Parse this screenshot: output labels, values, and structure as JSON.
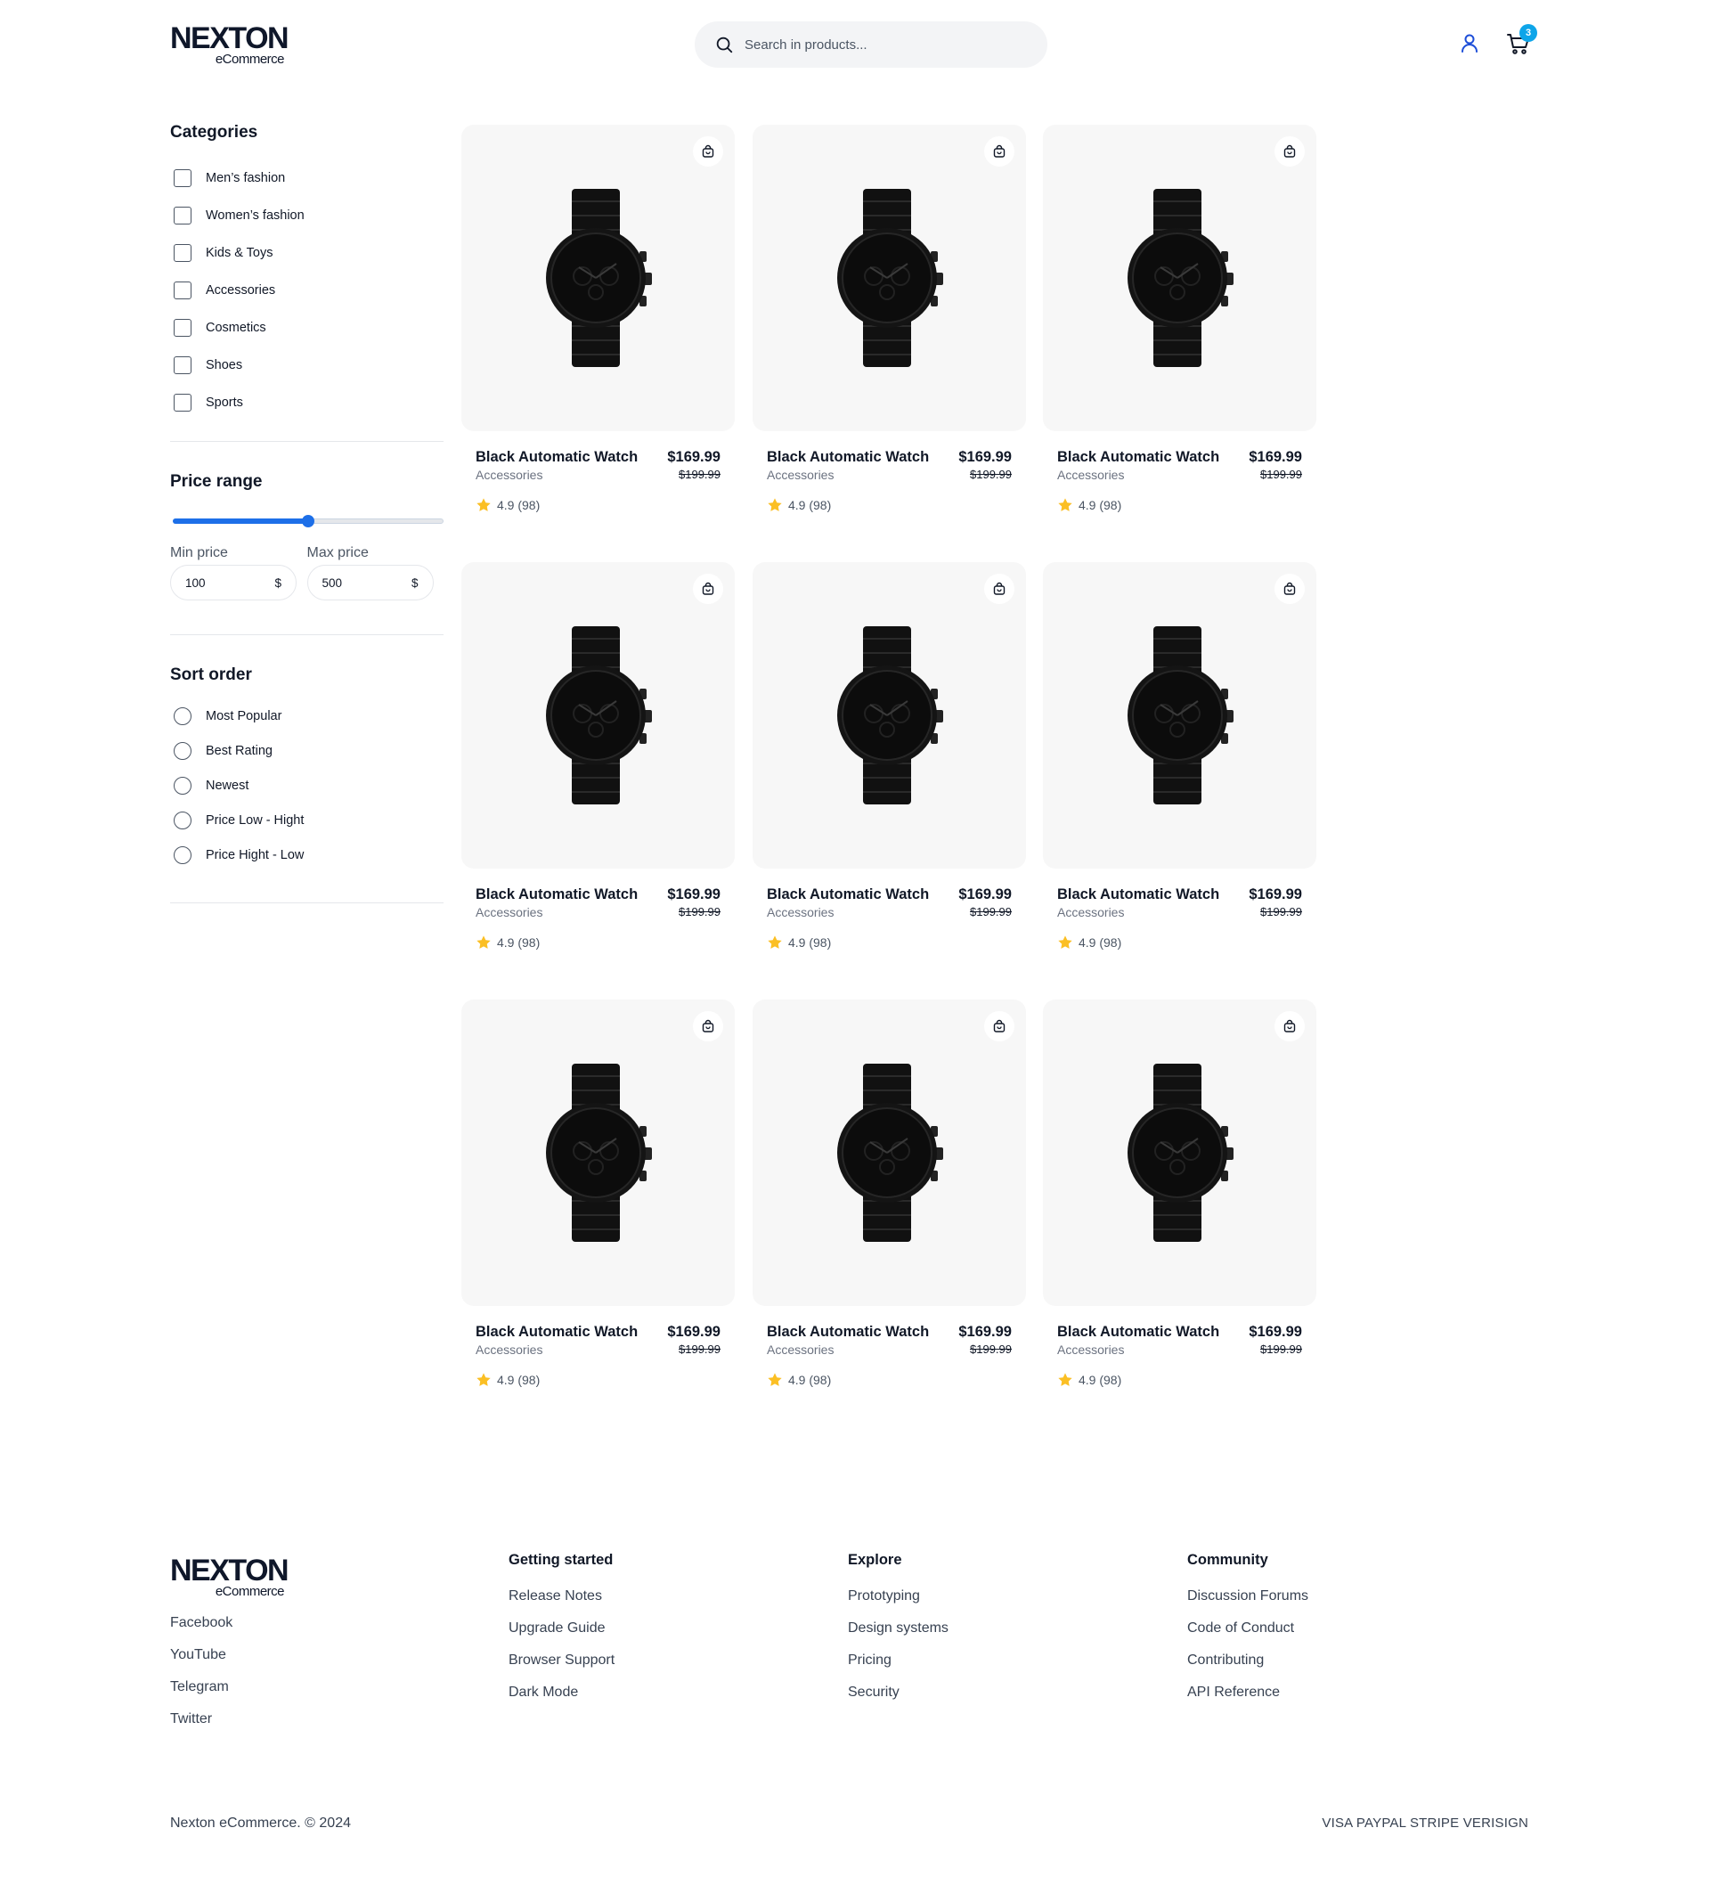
{
  "header": {
    "logo_main": "NEXTON",
    "logo_sub": "eCommerce",
    "search_placeholder": "Search in products...",
    "cart_count": "3"
  },
  "sidebar": {
    "categories_title": "Categories",
    "categories": [
      "Men’s fashion",
      "Women’s fashion",
      "Kids & Toys",
      "Accessories",
      "Cosmetics",
      "Shoes",
      "Sports"
    ],
    "price_range_title": "Price range",
    "price_range_fill_fraction": 0.5,
    "min_price_label": "Min price",
    "min_price_value": "100",
    "max_price_label": "Max price",
    "max_price_value": "500",
    "currency": "$",
    "sort_title": "Sort order",
    "sort_options": [
      "Most Popular",
      "Best Rating",
      "Newest",
      "Price Low - Hight",
      "Price Hight - Low"
    ]
  },
  "products": [
    {
      "name": "Black Automatic Watch",
      "category": "Accessories",
      "price": "$169.99",
      "old_price": "$199.99",
      "rating": "4.9 (98)"
    },
    {
      "name": "Black Automatic Watch",
      "category": "Accessories",
      "price": "$169.99",
      "old_price": "$199.99",
      "rating": "4.9 (98)"
    },
    {
      "name": "Black Automatic Watch",
      "category": "Accessories",
      "price": "$169.99",
      "old_price": "$199.99",
      "rating": "4.9 (98)"
    },
    {
      "name": "Black Automatic Watch",
      "category": "Accessories",
      "price": "$169.99",
      "old_price": "$199.99",
      "rating": "4.9 (98)"
    },
    {
      "name": "Black Automatic Watch",
      "category": "Accessories",
      "price": "$169.99",
      "old_price": "$199.99",
      "rating": "4.9 (98)"
    },
    {
      "name": "Black Automatic Watch",
      "category": "Accessories",
      "price": "$169.99",
      "old_price": "$199.99",
      "rating": "4.9 (98)"
    },
    {
      "name": "Black Automatic Watch",
      "category": "Accessories",
      "price": "$169.99",
      "old_price": "$199.99",
      "rating": "4.9 (98)"
    },
    {
      "name": "Black Automatic Watch",
      "category": "Accessories",
      "price": "$169.99",
      "old_price": "$199.99",
      "rating": "4.9 (98)"
    },
    {
      "name": "Black Automatic Watch",
      "category": "Accessories",
      "price": "$169.99",
      "old_price": "$199.99",
      "rating": "4.9 (98)"
    }
  ],
  "footer": {
    "logo_main": "NEXTON",
    "logo_sub": "eCommerce",
    "social": [
      "Facebook",
      "YouTube",
      "Telegram",
      "Twitter"
    ],
    "columns": [
      {
        "title": "Getting started",
        "links": [
          "Release Notes",
          "Upgrade Guide",
          "Browser Support",
          "Dark Mode"
        ]
      },
      {
        "title": "Explore",
        "links": [
          "Prototyping",
          "Design systems",
          "Pricing",
          "Security"
        ]
      },
      {
        "title": "Community",
        "links": [
          "Discussion Forums",
          "Code of Conduct",
          "Contributing",
          "API Reference"
        ]
      }
    ],
    "copyright": "Nexton eCommerce. © 2024",
    "payments": "VISA PAYPAL STRIPE VERISIGN"
  },
  "colors": {
    "accent": "#1d6fe8",
    "badge": "#0ea5e9",
    "star": "#fbbf24",
    "user_icon": "#1d4ed8"
  }
}
